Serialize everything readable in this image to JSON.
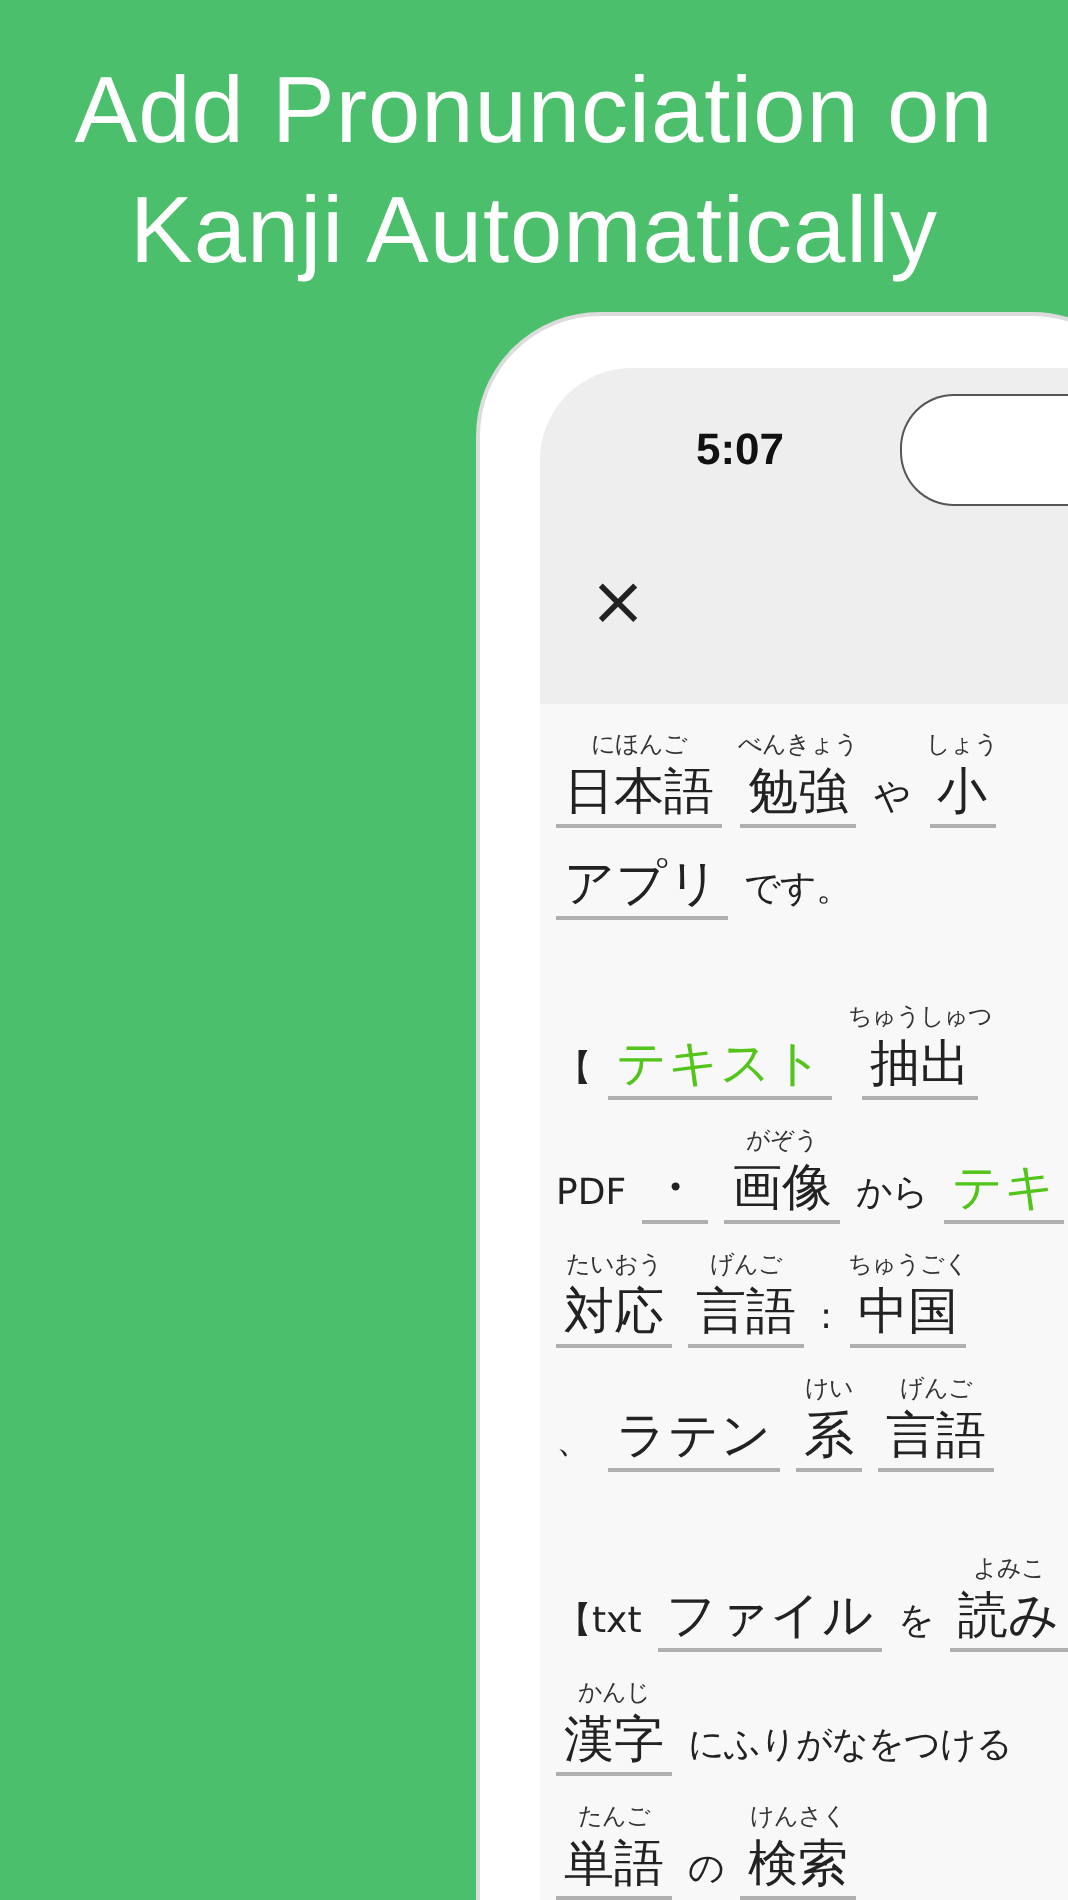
{
  "headline": [
    "Add Pronunciation on",
    "Kanji Automatically"
  ],
  "status_bar": {
    "time": "5:07"
  },
  "toolbar": {
    "close": "×"
  },
  "paragraphs": [
    [
      {
        "segments": [
          {
            "kind": "word",
            "text": "日本語",
            "ruby": "にほんご"
          },
          {
            "kind": "word",
            "text": "勉強",
            "ruby": "べんきょう"
          },
          {
            "kind": "plain",
            "text": "や"
          },
          {
            "kind": "word",
            "text": "小",
            "ruby": "しょう"
          }
        ]
      },
      {
        "segments": [
          {
            "kind": "word",
            "text": "アプリ"
          },
          {
            "kind": "plain",
            "text": "です。"
          }
        ]
      }
    ],
    [
      {
        "segments": [
          {
            "kind": "plain",
            "text": "【"
          },
          {
            "kind": "keyword",
            "text": "テキスト"
          },
          {
            "kind": "word",
            "text": "抽出",
            "ruby": "ちゅうしゅつ"
          }
        ]
      },
      {
        "segments": [
          {
            "kind": "plain",
            "text": "PDF"
          },
          {
            "kind": "word",
            "text": "・"
          },
          {
            "kind": "word",
            "text": "画像",
            "ruby": "がぞう"
          },
          {
            "kind": "plain",
            "text": "から"
          },
          {
            "kind": "keyword",
            "text": "テキ"
          }
        ]
      },
      {
        "segments": [
          {
            "kind": "word",
            "text": "対応",
            "ruby": "たいおう"
          },
          {
            "kind": "word",
            "text": "言語",
            "ruby": "げんご"
          },
          {
            "kind": "plain",
            "text": ":"
          },
          {
            "kind": "word",
            "text": "中国",
            "ruby": "ちゅうごく"
          }
        ]
      },
      {
        "segments": [
          {
            "kind": "plain",
            "text": "、"
          },
          {
            "kind": "word",
            "text": "ラテン"
          },
          {
            "kind": "word",
            "text": "系",
            "ruby": "けい"
          },
          {
            "kind": "word",
            "text": "言語",
            "ruby": "げんご"
          }
        ]
      }
    ],
    [
      {
        "segments": [
          {
            "kind": "plain",
            "text": "【txt"
          },
          {
            "kind": "word",
            "text": "ファイル"
          },
          {
            "kind": "plain",
            "text": "を"
          },
          {
            "kind": "word",
            "text": "読み",
            "ruby": "よみこ"
          }
        ]
      },
      {
        "segments": [
          {
            "kind": "word",
            "text": "漢字",
            "ruby": "かんじ"
          },
          {
            "kind": "plain",
            "text": "にふりがなをつける"
          }
        ]
      },
      {
        "segments": [
          {
            "kind": "word",
            "text": "単語",
            "ruby": "たんご"
          },
          {
            "kind": "plain",
            "text": "の"
          },
          {
            "kind": "word",
            "text": "検索",
            "ruby": "けんさく"
          }
        ]
      }
    ]
  ]
}
